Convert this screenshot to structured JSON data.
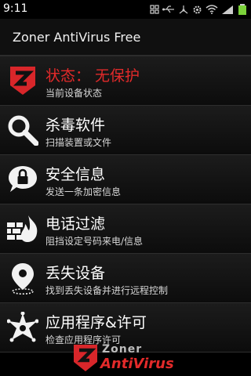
{
  "status_bar": {
    "time": "9:11",
    "icons": [
      "grid-icon",
      "usb-icon",
      "share-icon",
      "settings-icon",
      "wifi-icon",
      "signal-icon",
      "battery-icon"
    ]
  },
  "app": {
    "title": "Zoner AntiVirus Free"
  },
  "menu": {
    "items": [
      {
        "title": "状态： 无保护",
        "subtitle": "当前设备状态",
        "icon": "zoner-shield-icon",
        "title_color": "#e32a2a"
      },
      {
        "title": "杀毒软件",
        "subtitle": "扫描装置或文件",
        "icon": "search-icon"
      },
      {
        "title": "安全信息",
        "subtitle": "发送一条加密信息",
        "icon": "lock-chat-icon"
      },
      {
        "title": "电话过滤",
        "subtitle": "阻挡设定号码来电/信息",
        "icon": "firewall-icon"
      },
      {
        "title": "丢失设备",
        "subtitle": "找到丢失设备并进行远程控制",
        "icon": "location-pin-icon"
      },
      {
        "title": "应用程序&许可",
        "subtitle": "检查应用程序许可",
        "icon": "sheriff-badge-icon"
      }
    ]
  },
  "watermark": {
    "line1": "Zoner",
    "line2": "AntiVirus"
  },
  "colors": {
    "accent": "#e32a2a",
    "background": "#000000",
    "row_border": "#2e2e2e"
  }
}
